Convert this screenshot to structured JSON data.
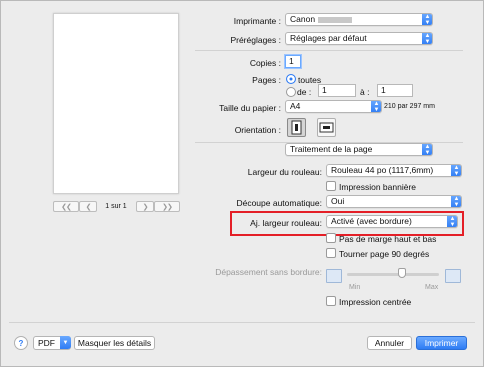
{
  "preview": {
    "page_indicator": "1 sur 1"
  },
  "printer": {
    "label": "Imprimante :",
    "value": "Canon"
  },
  "presets": {
    "label": "Préréglages :",
    "value": "Réglages par défaut"
  },
  "copies": {
    "label": "Copies :",
    "value": "1"
  },
  "pages": {
    "label": "Pages :",
    "all_label": "toutes",
    "range_label": "de :",
    "from": "1",
    "to_label": "à :",
    "to": "1"
  },
  "paper_size": {
    "label": "Taille du papier :",
    "value": "A4",
    "dims": "210 par 297 mm"
  },
  "orientation": {
    "label": "Orientation :"
  },
  "section": {
    "value": "Traitement de la page"
  },
  "roll_width": {
    "label": "Largeur du rouleau:",
    "value": "Rouleau 44 po (1117,6mm)"
  },
  "banner": {
    "label": "Impression bannière"
  },
  "auto_cut": {
    "label": "Découpe automatique:",
    "value": "Oui"
  },
  "fit_roll": {
    "label": "Aj. largeur rouleau:",
    "value": "Activé (avec bordure)"
  },
  "no_margin": {
    "label": "Pas de marge haut et bas"
  },
  "rotate": {
    "label": "Tourner page 90 degrés"
  },
  "overflow": {
    "label": "Dépassement sans bordure:",
    "min": "Min",
    "max": "Max",
    "level": 0.6
  },
  "centered": {
    "label": "Impression centrée"
  },
  "footer": {
    "help": "?",
    "pdf": "PDF",
    "hide_details": "Masquer les détails",
    "cancel": "Annuler",
    "print": "Imprimer"
  }
}
